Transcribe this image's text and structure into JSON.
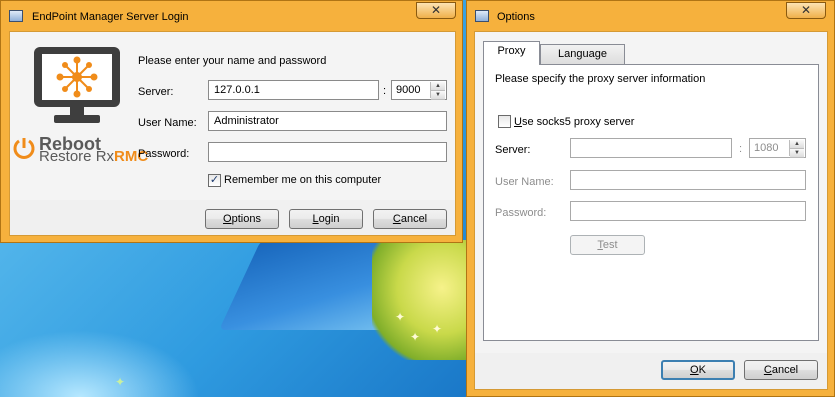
{
  "login_window": {
    "title": "EndPoint Manager Server Login",
    "close_glyph": "✕",
    "prompt": "Please enter your name and password",
    "server_label": "Server:",
    "server_value": "127.0.0.1",
    "port_separator": ":",
    "port_value": "9000",
    "username_label": "User Name:",
    "username_value": "Administrator",
    "password_label": "Password:",
    "password_value": "",
    "remember_label": "Remember me on this computer",
    "remember_checked": true,
    "options_button": "Options",
    "login_button": "Login",
    "cancel_button": "Cancel",
    "logo": {
      "line1": "Reboot",
      "line2": "Restore Rx",
      "line2_suffix": "RMC",
      "monitor_icon": "monitor-network-icon",
      "power_icon": "power-icon"
    }
  },
  "options_window": {
    "title": "Options",
    "close_glyph": "✕",
    "tabs": [
      {
        "label": "Proxy",
        "active": true
      },
      {
        "label": "Language",
        "active": false
      }
    ],
    "description": "Please specify the proxy server information",
    "socks5_label": "Use socks5 proxy server",
    "socks5_checked": false,
    "server_label": "Server:",
    "server_value": "",
    "port_separator": ":",
    "port_value": "1080",
    "username_label": "User Name:",
    "username_value": "",
    "password_label": "Password:",
    "password_value": "",
    "test_button": "Test",
    "ok_button": "OK",
    "cancel_button": "Cancel"
  },
  "colors": {
    "window_frame": "#f6b13d",
    "client_bg": "#f4f4f4",
    "accent_orange": "#f08c1a"
  }
}
